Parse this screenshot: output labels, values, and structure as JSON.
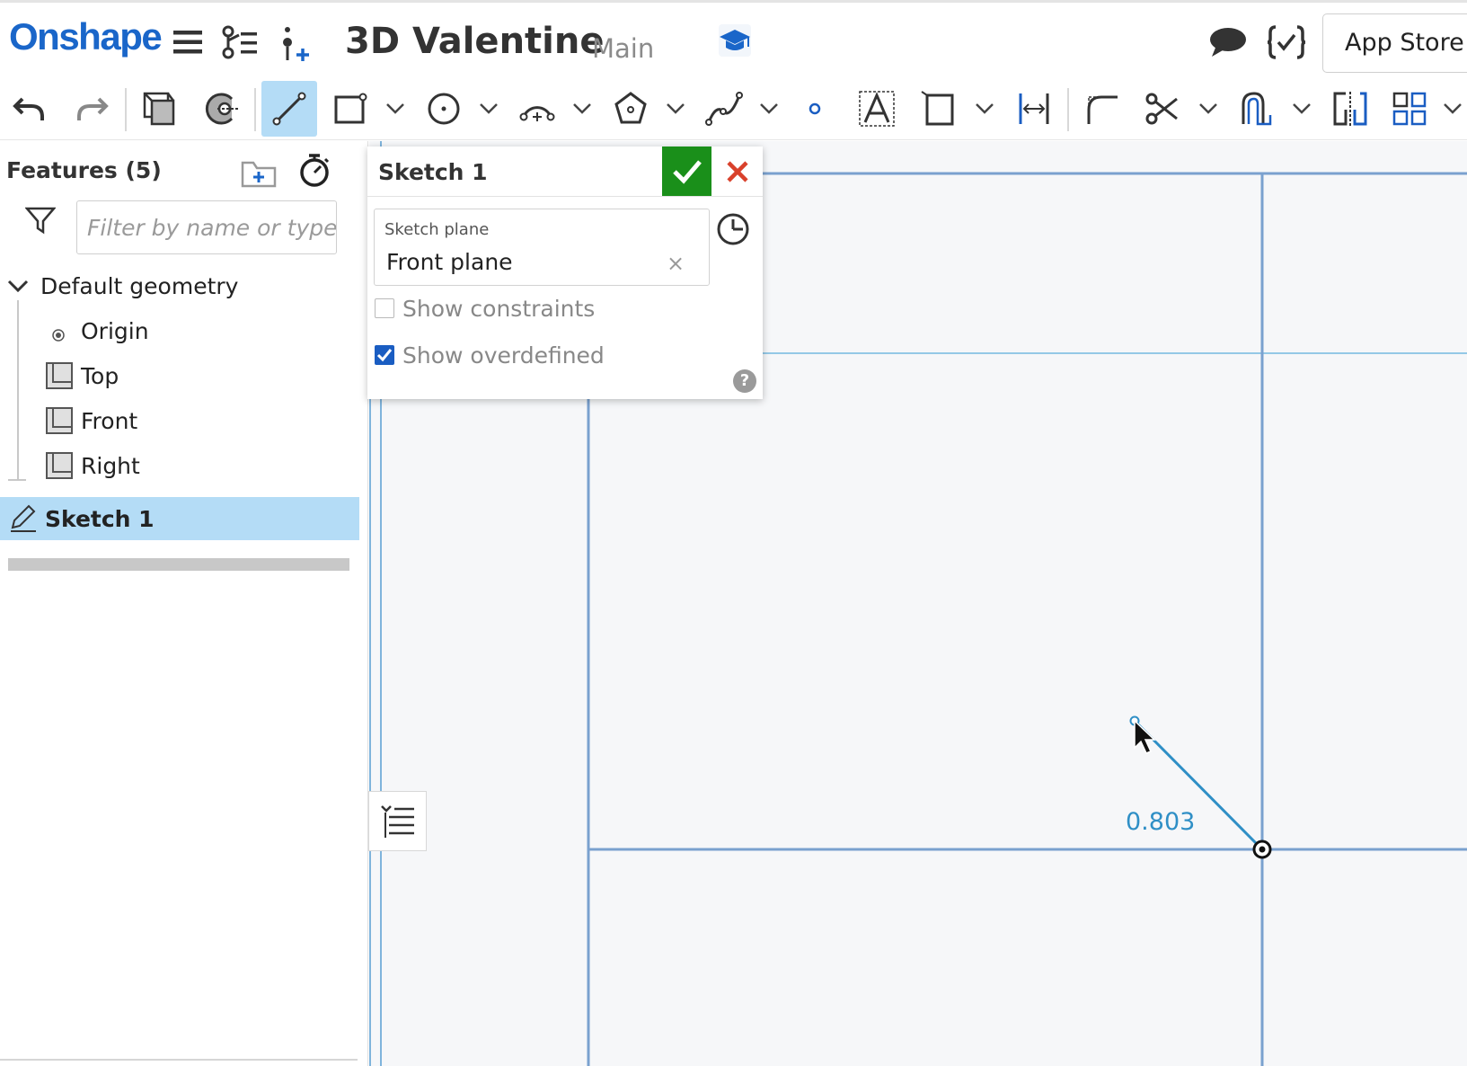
{
  "app": {
    "logo": "Onshape"
  },
  "document": {
    "title": "3D Valentine",
    "branch": "Main"
  },
  "header": {
    "app_store_label": "App Store"
  },
  "icons": {
    "menu": "hamburger-icon",
    "versions": "version-graph-icon",
    "insert": "insert-icon",
    "learning": "graduation-cap-icon",
    "comments": "comment-icon",
    "featurescript": "featurescript-icon"
  },
  "toolbar": {
    "tools": [
      "undo",
      "redo",
      "use-projection",
      "intersect",
      "line",
      "rectangle",
      "circle",
      "arc",
      "polygon",
      "spline",
      "point",
      "text",
      "construction",
      "trim",
      "offset",
      "fillet",
      "split",
      "mirror",
      "pattern"
    ]
  },
  "features": {
    "title": "Features (5)",
    "filter_placeholder": "Filter by name or type",
    "default_geometry": "Default geometry",
    "items": [
      {
        "label": "Origin",
        "icon": "origin-icon"
      },
      {
        "label": "Top",
        "icon": "plane-icon"
      },
      {
        "label": "Front",
        "icon": "plane-icon"
      },
      {
        "label": "Right",
        "icon": "plane-icon"
      }
    ],
    "selected": "Sketch 1"
  },
  "sketch_dialog": {
    "title": "Sketch 1",
    "plane_label": "Sketch plane",
    "plane_value": "Front plane",
    "clear_glyph": "×",
    "show_constraints_label": "Show constraints",
    "show_constraints_checked": false,
    "show_overdefined_label": "Show overdefined",
    "show_overdefined_checked": true,
    "help_glyph": "?"
  },
  "canvas": {
    "dimension_value": "0.803"
  },
  "colors": {
    "brand": "#1a66c9",
    "accept": "#1a8f1a",
    "cancel": "#d9412b",
    "selection": "#b4dcf6",
    "sketch_line": "#2f8fc6",
    "plane_edge": "#7aa1cf"
  }
}
